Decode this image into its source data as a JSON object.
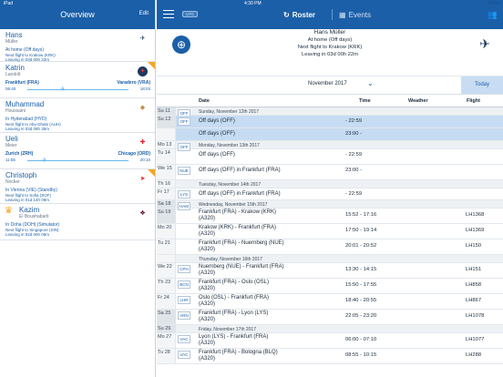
{
  "status": {
    "left": "iPad",
    "time": "4:30 PM",
    "right": "100%"
  },
  "sidebar": {
    "title": "Overview",
    "edit": "Edit",
    "people": [
      {
        "first": "Hans",
        "last": "Müller",
        "line1": "At home (Off days)",
        "line2": "Next flight to Krakow (KRK)",
        "line3": "Leaving in 03d 00h 22m"
      },
      {
        "first": "Katrin",
        "last": "Landolt",
        "from": "Frankfurt (FRA)",
        "to": "Varadero (VRA)",
        "dep": "06:40",
        "arr": "18:03"
      },
      {
        "first": "Muhammad",
        "last": "Houssaini",
        "line1": "In Hyderabad (HYD)",
        "line2": "Next flight to Abu Dhabi (AUH)",
        "line3": "Leaving in 03d 08h 35m"
      },
      {
        "first": "Ueli",
        "last": "Meier",
        "from": "Zurich (ZRH)",
        "to": "Chicago (ORD)",
        "dep": "11:55",
        "arr": "20:10"
      },
      {
        "first": "Christoph",
        "last": "Nocker",
        "line1": "In Vienna (VIE) (Standby)",
        "line2": "Next flight to Sofia (SOF)",
        "line3": "Leaving in 01d 14h 09m"
      },
      {
        "first": "Kazim",
        "last": "El Boushabarti",
        "line1": "In Doha (DOH) (Simulator)",
        "line2": "Next flight to Singapore (SIN)",
        "line3": "Leaving in 02d 00h 05m"
      }
    ]
  },
  "topbar": {
    "utc": "UTC",
    "roster": "Roster",
    "events": "Events"
  },
  "profile": {
    "name": "Hans Müller",
    "line1": "At home (Off days)",
    "line2": "Next flight to Krakow (KRK)",
    "line3": "Leaving in 03d 00h 22m"
  },
  "month": {
    "label": "November 2017",
    "today": "Today"
  },
  "columns": {
    "date": "Date",
    "time": "Time",
    "weather": "Weather",
    "flight": "Flight"
  },
  "rows": [
    {
      "type": "header",
      "day": "Su 11",
      "code": "OFF",
      "desc": "Sunday, November 12th 2017",
      "h": 9
    },
    {
      "type": "row",
      "day": "Su 12",
      "code": "OFF",
      "desc": "Off days (OFF)",
      "time": "- 22:59",
      "h": 14,
      "hl": true
    },
    {
      "type": "row",
      "day": "",
      "code": "",
      "desc": "Off days (OFF)",
      "time": "23:00 -",
      "h": 14,
      "hl": true
    },
    {
      "type": "header",
      "day": "Mo 13",
      "code": "OFF",
      "desc": "Monday, November 13th 2017",
      "h": 9
    },
    {
      "type": "row",
      "day": "Tu 14",
      "code": "",
      "desc": "Off days (OFF)",
      "time": "- 22:59",
      "h": 17
    },
    {
      "type": "row",
      "day": "We 15",
      "code": "NUE",
      "desc": "Off days (OFF) in Frankfurt (FRA)",
      "time": "23:00 -",
      "h": 17
    },
    {
      "type": "header",
      "day": "Th 16",
      "code": "",
      "desc": "Tuesday, November 14th 2017",
      "h": 9
    },
    {
      "type": "row",
      "day": "Fr 17",
      "code": "LYS",
      "desc": "Off days (OFF) in Frankfurt (FRA)",
      "time": "- 22:59",
      "h": 13
    },
    {
      "type": "header",
      "day": "Sa 18",
      "code": "HAM",
      "desc": "Wednesday, November 15th 2017",
      "h": 9
    },
    {
      "type": "row",
      "day": "Su 19",
      "code": "",
      "desc": "Frankfurt (FRA) - Krakow (KRK)|(A320)",
      "time": "15:52 - 17:16",
      "flt": "LH1368",
      "h": 17
    },
    {
      "type": "row",
      "day": "Mo 20",
      "code": "",
      "desc": "Krakow (KRK) - Frankfurt (FRA)|(A320)",
      "time": "17:50 - 19:14",
      "flt": "LH1369",
      "h": 17
    },
    {
      "type": "row",
      "day": "Tu 21",
      "code": "",
      "desc": "Frankfurt (FRA) - Nuernberg (NUE)|(A320)",
      "time": "20:01 - 20:52",
      "flt": "LH150",
      "h": 17
    },
    {
      "type": "header",
      "day": "",
      "code": "",
      "desc": "Thursday, November 16th 2017",
      "h": 9
    },
    {
      "type": "row",
      "day": "We 22",
      "code": "CPH",
      "desc": "Nuernberg (NUE) - Frankfurt (FRA)|(A320)",
      "time": "13:30 - 14:15",
      "flt": "LH151",
      "h": 17
    },
    {
      "type": "row",
      "day": "Th 23",
      "code": "BCN",
      "desc": "Frankfurt (FRA) - Oslo (OSL)|(A320)",
      "time": "15:50 - 17:55",
      "flt": "LH858",
      "h": 17
    },
    {
      "type": "row",
      "day": "Fr 24",
      "code": "LHR",
      "desc": "Oslo (OSL) - Frankfurt (FRA)|(A320)",
      "time": "18:40 - 20:55",
      "flt": "LH867",
      "h": 17
    },
    {
      "type": "row",
      "day": "Sa 25",
      "code": "ARN",
      "desc": "Frankfurt (FRA) - Lyon (LYS)|(A320)",
      "time": "22:05 - 23:20",
      "flt": "LH1078",
      "h": 17
    },
    {
      "type": "header",
      "day": "Su 26",
      "code": "",
      "desc": "Friday, November 17th 2017",
      "h": 9
    },
    {
      "type": "row",
      "day": "Mo 27",
      "code": "VAC",
      "desc": "Lyon (LYS) - Frankfurt (FRA)|(A320)",
      "time": "06:00 - 07:10",
      "flt": "LH1077",
      "h": 17
    },
    {
      "type": "row",
      "day": "Tu 28",
      "code": "VAC",
      "desc": "Frankfurt (FRA) - Bologna (BLQ)|(A320)",
      "time": "08:55 - 10:15",
      "flt": "LH288",
      "h": 17
    }
  ]
}
